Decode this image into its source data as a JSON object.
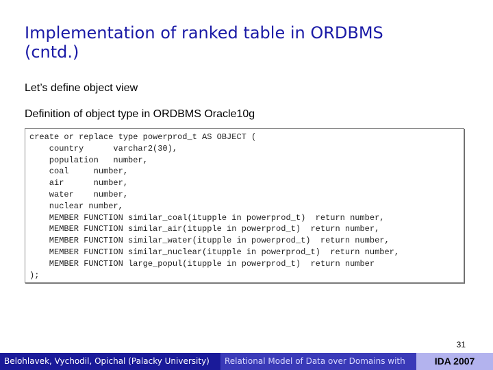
{
  "slide": {
    "title_lines": [
      "Implementation of ranked table in ORDBMS",
      "(cntd.)"
    ],
    "subtitle": "Let’s define object view",
    "definition_heading": "Definition of object type in ORDBMS Oracle10g",
    "code_lines": [
      "create or replace type powerprod_t AS OBJECT (",
      "    country      varchar2(30),",
      "    population   number,",
      "    coal     number,",
      "    air      number,",
      "    water    number,",
      "    nuclear number,",
      "    MEMBER FUNCTION similar_coal(itupple in powerprod_t)  return number,",
      "    MEMBER FUNCTION similar_air(itupple in powerprod_t)  return number,",
      "    MEMBER FUNCTION similar_water(itupple in powerprod_t)  return number,",
      "    MEMBER FUNCTION similar_nuclear(itupple in powerprod_t)  return number,",
      "    MEMBER FUNCTION large_popul(itupple in powerprod_t)  return number",
      ");"
    ],
    "page_number": "31"
  },
  "footer": {
    "authors": "Belohlavek, Vychodil, Opichal (Palacky University)",
    "course": "Relational Model of Data over Domains with",
    "event": "IDA 2007"
  },
  "colors": {
    "title": "#1a1aa6",
    "footer_dark": "#1a1a99",
    "footer_mid": "#3a3ab8",
    "footer_light": "#b3b3ee"
  }
}
